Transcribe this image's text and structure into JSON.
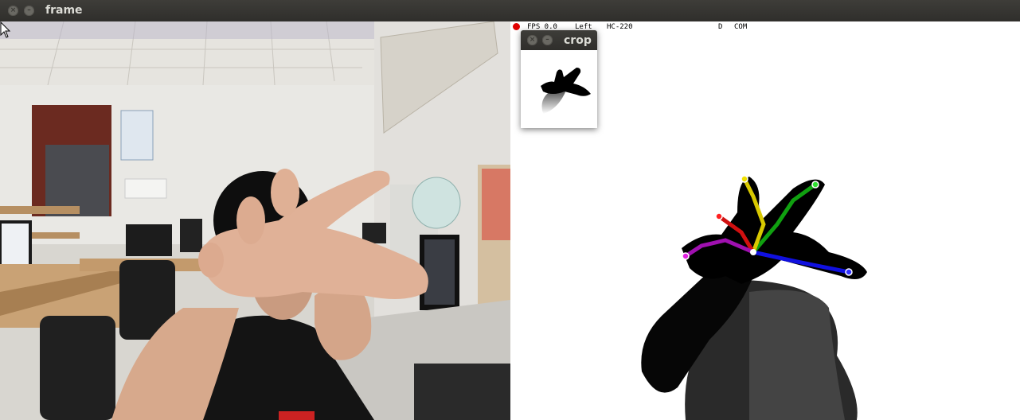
{
  "window": {
    "title": "frame",
    "close_glyph": "×",
    "minimize_glyph": "–"
  },
  "depth_hud": {
    "fps": "FPS 0.0",
    "hand": "Left",
    "device": "HC-220",
    "mode": "D",
    "com": "COM"
  },
  "crop_window": {
    "title": "crop"
  },
  "skeleton_colors": {
    "thumb": "#1010e0",
    "index": "#10a010",
    "middle": "#d8c800",
    "ring": "#d01010",
    "pinky": "#a010b0",
    "tip_thumb": "#3030ff",
    "tip_index": "#30e030",
    "tip_middle": "#f0e000",
    "tip_ring": "#ff2020",
    "tip_pinky": "#e020e0"
  },
  "icons": {
    "close": "close-icon",
    "minimize": "minimize-icon",
    "cursor": "mouse-pointer-icon"
  }
}
